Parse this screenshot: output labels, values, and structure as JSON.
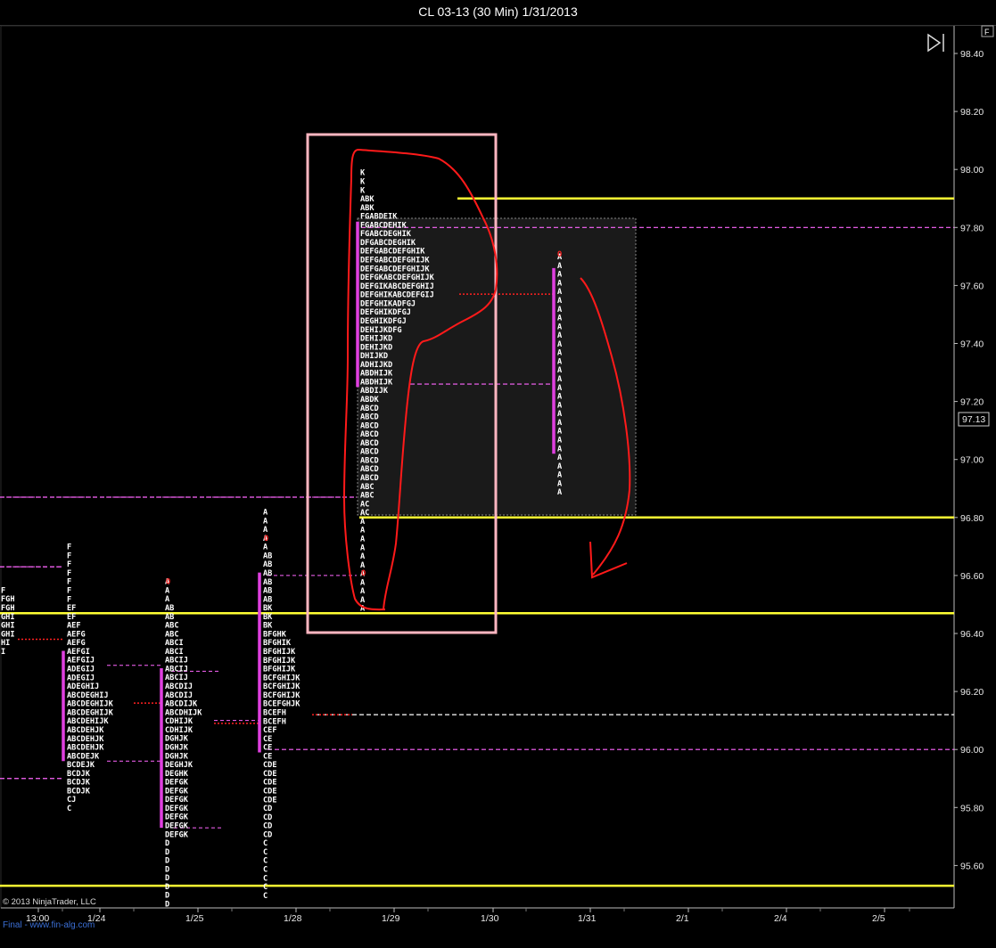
{
  "window": {
    "title": "CL 03-13 (30 Min)  1/31/2013"
  },
  "panel_button": "F",
  "copyright": "© 2013 NinjaTrader, LLC",
  "watermark": "Final - www.fin-alg.com",
  "current_price_label": "97.13",
  "colors": {
    "background": "#000000",
    "level_line": "#ffff33",
    "value_area_marker": "#e040e0",
    "poc_dashed": "#ff66ff",
    "poc_dot_red": "#ff2020",
    "pink_box": "#ffb6c1",
    "annotation": "#ff1a1a",
    "tpo_text": "#ffffff"
  },
  "chart_data": {
    "type": "market-profile",
    "symbol": "CL 03-13",
    "interval": "30 Min",
    "y_ticks": [
      "98.40",
      "98.20",
      "98.00",
      "97.80",
      "97.60",
      "97.40",
      "97.20",
      "97.00",
      "96.80",
      "96.60",
      "96.40",
      "96.20",
      "96.00",
      "95.80",
      "95.60"
    ],
    "ylim": [
      95.47,
      98.5
    ],
    "x_ticks": [
      "13:00",
      "1/24",
      "1/25",
      "1/28",
      "1/29",
      "1/30",
      "1/31",
      "2/1",
      "2/4",
      "2/5"
    ],
    "horizontal_levels": [
      97.9,
      96.8,
      96.47,
      95.53
    ],
    "profiles": [
      {
        "date": "1/23",
        "top": 96.54,
        "rows": [
          "F",
          "FGH",
          "FGH",
          "GHI",
          "GHI",
          "GHI",
          "HI",
          "I"
        ]
      },
      {
        "date": "1/24",
        "top": 96.69,
        "rows": [
          "F",
          "F",
          "F",
          "F",
          "F",
          "F",
          "F",
          "EF",
          "EF",
          "AEF",
          "AEFG",
          "AEFG",
          "AEFGI",
          "AEFGIJ",
          "ADEGIJ",
          "ADEGIJ",
          "ADEGHIJ",
          "ABCDEGHIJ",
          "ABCDEGHIJK",
          "ABCDEGHIJK",
          "ABCDEHIJK",
          "ABCDEHJK",
          "ABCDEHJK",
          "ABCDEHJK",
          "ABCDEJK",
          "BCDEJK",
          "BCDJK",
          "BCDJK",
          "BCDJK",
          "CJ",
          "C"
        ]
      },
      {
        "date": "1/25",
        "top": 96.57,
        "rows": [
          "A",
          "A",
          "A",
          "AB",
          "AB",
          "ABC",
          "ABC",
          "ABCI",
          "ABCI",
          "ABCIJ",
          "ABCIJ",
          "ABCIJ",
          "ABCDIJ",
          "ABCDIJ",
          "ABCDIJK",
          "ABCDHIJK",
          "CDHIJK",
          "CDHIJK",
          "DGHJK",
          "DGHJK",
          "DGHJK",
          "DEGHJK",
          "DEGHK",
          "DEFGK",
          "DEFGK",
          "DEFGK",
          "DEFGK",
          "DEFGK",
          "DEFGK",
          "DEFGK",
          "D",
          "D",
          "D",
          "D",
          "D",
          "D",
          "D",
          "D"
        ]
      },
      {
        "date": "1/28",
        "top": 96.81,
        "rows": [
          "A",
          "A",
          "A",
          "A",
          "A",
          "AB",
          "AB",
          "AB",
          "AB",
          "AB",
          "AB",
          "BK",
          "BK",
          "BK",
          "BFGHK",
          "BFGHIK",
          "BFGHIJK",
          "BFGHIJK",
          "BFGHIJK",
          "BCFGHIJK",
          "BCFGHIJK",
          "BCFGHIJK",
          "BCEFGHJK",
          "BCEFH",
          "BCEFH",
          "CEF",
          "CE",
          "CE",
          "CE",
          "CDE",
          "CDE",
          "CDE",
          "CDE",
          "CDE",
          "CD",
          "CD",
          "CD",
          "CD",
          "C",
          "C",
          "C",
          "C",
          "C",
          "C",
          "C"
        ]
      },
      {
        "date": "1/29",
        "top": 97.98,
        "rows": [
          "K",
          "K",
          "K",
          "ABK",
          "ABK",
          "FGABDEIK",
          "FGABCDEHIK",
          "FGABCDEGHIK",
          "DFGABCDEGHIK",
          "DEFGABCDEFGHIK",
          "DEFGABCDEFGHIJK",
          "DEFGABCDEFGHIJK",
          "DEFGKABCDEFGHIJK",
          "DEFGIKABCDEFGHIJ",
          "DEFGHIKABCDEFGIJ",
          "DEFGHIKADFGJ",
          "DEFGHIKDFGJ",
          "DEGHIKDFGJ",
          "DEHIJKDFG",
          "DEHIJKD",
          "DEHIJKD",
          "DHIJKD",
          "ADHIJKD",
          "ABDHIJK",
          "ABDHIJK",
          "ABDIJK",
          "ABDK",
          "ABCD",
          "ABCD",
          "ABCD",
          "ABCD",
          "ABCD",
          "ABCD",
          "ABCD",
          "ABCD",
          "ABCD",
          "ABC",
          "ABC",
          "AC",
          "AC",
          "A",
          "A",
          "A",
          "A",
          "A",
          "A",
          "A",
          "A",
          "A",
          "A",
          "A"
        ]
      },
      {
        "date": "1/31",
        "top": 97.69,
        "rows": [
          "A",
          "A",
          "A",
          "A",
          "A",
          "A",
          "A",
          "A",
          "A",
          "A",
          "A",
          "A",
          "A",
          "A",
          "A",
          "A",
          "A",
          "A",
          "A",
          "A",
          "A",
          "A",
          "A",
          "A",
          "A",
          "A",
          "A",
          "A"
        ]
      }
    ],
    "poc_lines": [
      97.8,
      97.26,
      96.87,
      96.63,
      96.12,
      96.0,
      95.9
    ],
    "annotation": "hand-drawn red arrow pointing down toward 96.60"
  }
}
